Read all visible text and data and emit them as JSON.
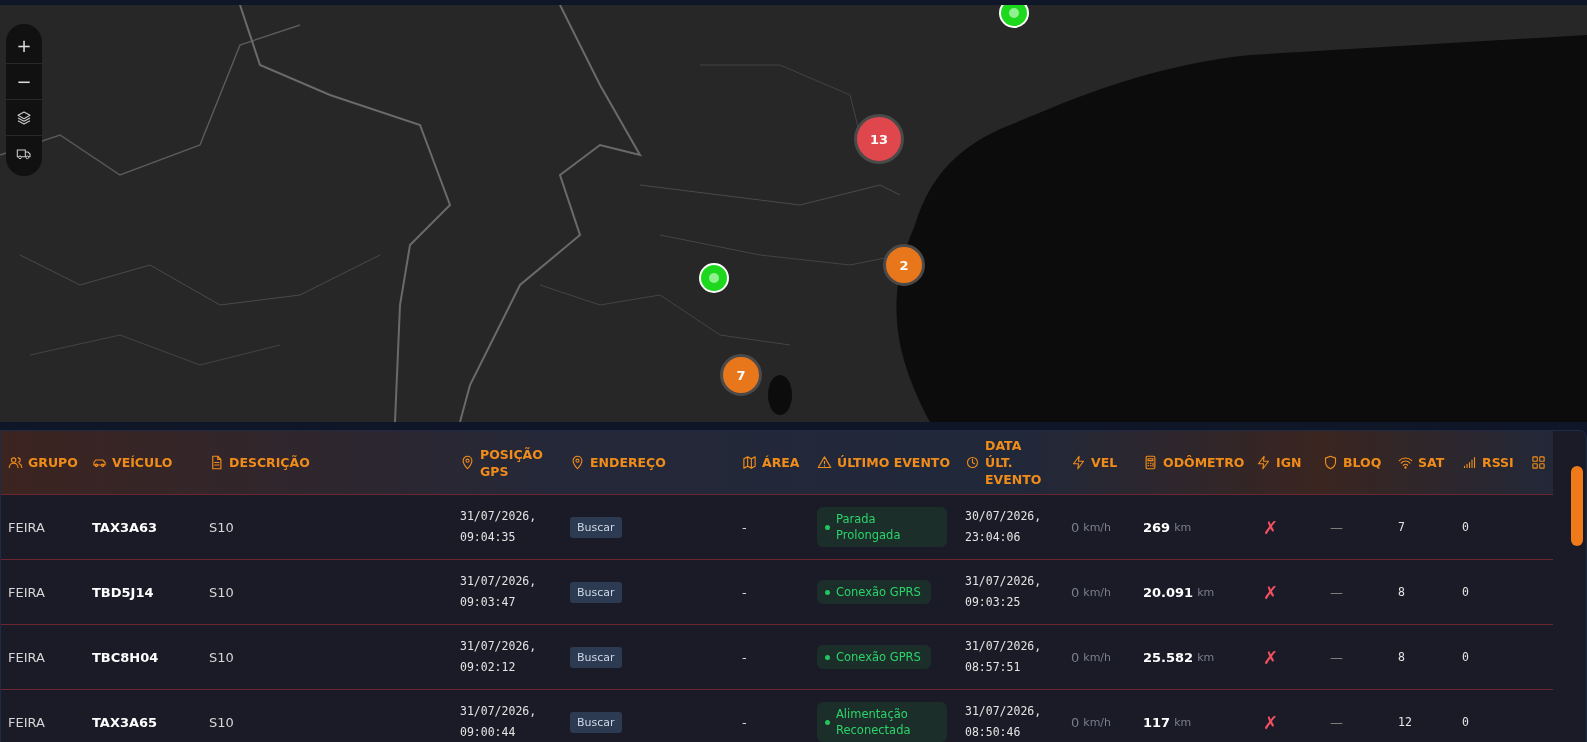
{
  "map": {
    "controls": [
      {
        "kind": "zoom-in",
        "label": "+"
      },
      {
        "kind": "zoom-out",
        "label": "−"
      },
      {
        "kind": "layers"
      },
      {
        "kind": "vehicles"
      }
    ],
    "markers": [
      {
        "kind": "vehicle"
      },
      {
        "kind": "vehicle"
      },
      {
        "kind": "cluster",
        "count": "13",
        "color": "#e0474c"
      },
      {
        "kind": "cluster",
        "count": "2",
        "color": "#e8761a"
      },
      {
        "kind": "cluster",
        "count": "7",
        "color": "#e8761a"
      }
    ]
  },
  "table": {
    "columns": [
      "GRUPO",
      "VEÍCULO",
      "DESCRIÇÃO",
      "POSIÇÃO GPS",
      "ENDEREÇO",
      "ÁREA",
      "ÚLTIMO EVENTO",
      "DATA ÚLT. EVENTO",
      "VEL",
      "ODÔMETRO",
      "IGN",
      "BLOQ",
      "SAT",
      "RSSI"
    ],
    "rows": [
      {
        "grupo": "FEIRA",
        "veiculo": "TAX3A63",
        "descricao": "S10",
        "posicao": "31/07/2026, 09:04:35",
        "endereco": "Buscar",
        "area": "-",
        "evento": "Parada Prolongada",
        "data": "30/07/2026, 23:04:06",
        "vel": "0",
        "vel_unit": "km/h",
        "odometro": "269",
        "odo_unit": "km",
        "ign": "✗",
        "bloq": "—",
        "sat": "7",
        "rssi": "0"
      },
      {
        "grupo": "FEIRA",
        "veiculo": "TBD5J14",
        "descricao": "S10",
        "posicao": "31/07/2026, 09:03:47",
        "endereco": "Buscar",
        "area": "-",
        "evento": "Conexão GPRS",
        "data": "31/07/2026, 09:03:25",
        "vel": "0",
        "vel_unit": "km/h",
        "odometro": "20.091",
        "odo_unit": "km",
        "ign": "✗",
        "bloq": "—",
        "sat": "8",
        "rssi": "0"
      },
      {
        "grupo": "FEIRA",
        "veiculo": "TBC8H04",
        "descricao": "S10",
        "posicao": "31/07/2026, 09:02:12",
        "endereco": "Buscar",
        "area": "-",
        "evento": "Conexão GPRS",
        "data": "31/07/2026, 08:57:51",
        "vel": "0",
        "vel_unit": "km/h",
        "odometro": "25.582",
        "odo_unit": "km",
        "ign": "✗",
        "bloq": "—",
        "sat": "8",
        "rssi": "0"
      },
      {
        "grupo": "FEIRA",
        "veiculo": "TAX3A65",
        "descricao": "S10",
        "posicao": "31/07/2026, 09:00:44",
        "endereco": "Buscar",
        "area": "-",
        "evento": "Alimentação Reconectada",
        "data": "31/07/2026, 08:50:46",
        "vel": "0",
        "vel_unit": "km/h",
        "odometro": "117",
        "odo_unit": "km",
        "ign": "✗",
        "bloq": "—",
        "sat": "12",
        "rssi": "0"
      }
    ]
  }
}
